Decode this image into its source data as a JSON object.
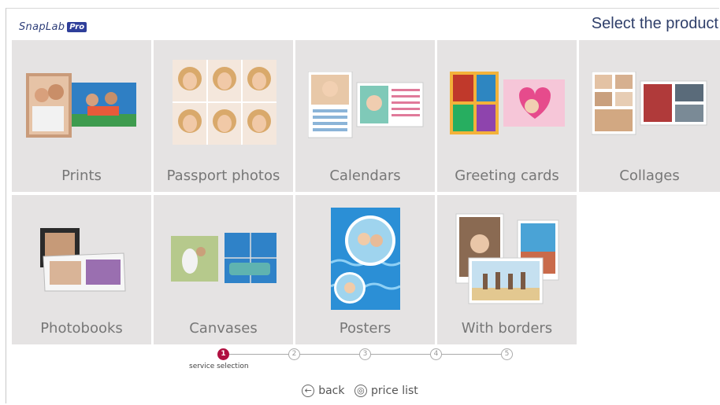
{
  "header": {
    "logo_text": "SnapLab",
    "logo_badge": "Pro",
    "title": "Select the product"
  },
  "products": [
    {
      "label": "Prints"
    },
    {
      "label": "Passport photos"
    },
    {
      "label": "Calendars"
    },
    {
      "label": "Greeting cards"
    },
    {
      "label": "Collages"
    },
    {
      "label": "Photobooks"
    },
    {
      "label": "Canvases"
    },
    {
      "label": "Posters"
    },
    {
      "label": "With borders"
    }
  ],
  "stepper": {
    "steps": [
      "1",
      "2",
      "3",
      "4",
      "5"
    ],
    "active_step": 1,
    "active_caption": "service selection",
    "active_color": "#b01040"
  },
  "footer": {
    "back_label": "back",
    "price_label": "price list"
  }
}
